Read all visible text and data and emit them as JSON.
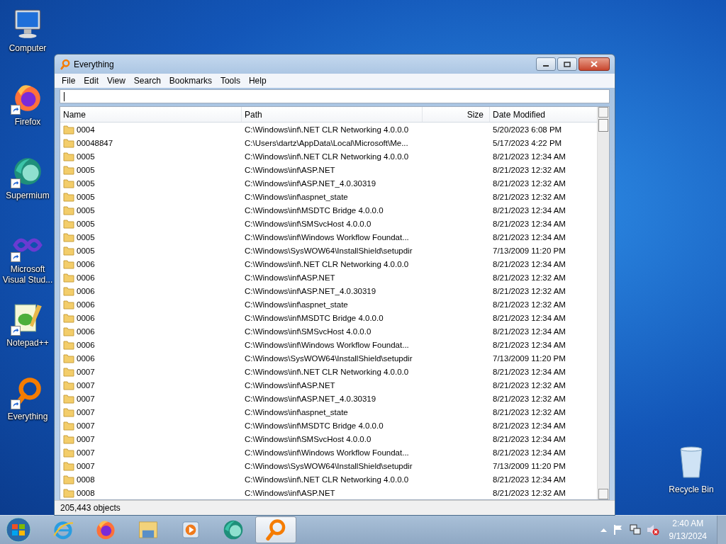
{
  "desktop_icons": [
    {
      "label": "Computer",
      "kind": "computer",
      "shortcut": false
    },
    {
      "label": "Firefox",
      "kind": "firefox",
      "shortcut": true
    },
    {
      "label": "Supermium",
      "kind": "supermium",
      "shortcut": true
    },
    {
      "label": "Microsoft Visual Stud...",
      "kind": "vs",
      "shortcut": true
    },
    {
      "label": "Notepad++",
      "kind": "notepad",
      "shortcut": true
    },
    {
      "label": "Everything",
      "kind": "everything",
      "shortcut": true
    }
  ],
  "recycle_bin": {
    "label": "Recycle Bin"
  },
  "window": {
    "title": "Everything",
    "menu": [
      "File",
      "Edit",
      "View",
      "Search",
      "Bookmarks",
      "Tools",
      "Help"
    ],
    "table": {
      "columns": [
        "Name",
        "Path",
        "Size",
        "Date Modified"
      ],
      "rows": [
        [
          "0004",
          "C:\\Windows\\inf\\.NET CLR Networking 4.0.0.0",
          "",
          "5/20/2023 6:08 PM"
        ],
        [
          "00048847",
          "C:\\Users\\dartz\\AppData\\Local\\Microsoft\\Me...",
          "",
          "5/17/2023 4:22 PM"
        ],
        [
          "0005",
          "C:\\Windows\\inf\\.NET CLR Networking 4.0.0.0",
          "",
          "8/21/2023 12:34 AM"
        ],
        [
          "0005",
          "C:\\Windows\\inf\\ASP.NET",
          "",
          "8/21/2023 12:32 AM"
        ],
        [
          "0005",
          "C:\\Windows\\inf\\ASP.NET_4.0.30319",
          "",
          "8/21/2023 12:32 AM"
        ],
        [
          "0005",
          "C:\\Windows\\inf\\aspnet_state",
          "",
          "8/21/2023 12:32 AM"
        ],
        [
          "0005",
          "C:\\Windows\\inf\\MSDTC Bridge 4.0.0.0",
          "",
          "8/21/2023 12:34 AM"
        ],
        [
          "0005",
          "C:\\Windows\\inf\\SMSvcHost 4.0.0.0",
          "",
          "8/21/2023 12:34 AM"
        ],
        [
          "0005",
          "C:\\Windows\\inf\\Windows Workflow Foundat...",
          "",
          "8/21/2023 12:34 AM"
        ],
        [
          "0005",
          "C:\\Windows\\SysWOW64\\InstallShield\\setupdir",
          "",
          "7/13/2009 11:20 PM"
        ],
        [
          "0006",
          "C:\\Windows\\inf\\.NET CLR Networking 4.0.0.0",
          "",
          "8/21/2023 12:34 AM"
        ],
        [
          "0006",
          "C:\\Windows\\inf\\ASP.NET",
          "",
          "8/21/2023 12:32 AM"
        ],
        [
          "0006",
          "C:\\Windows\\inf\\ASP.NET_4.0.30319",
          "",
          "8/21/2023 12:32 AM"
        ],
        [
          "0006",
          "C:\\Windows\\inf\\aspnet_state",
          "",
          "8/21/2023 12:32 AM"
        ],
        [
          "0006",
          "C:\\Windows\\inf\\MSDTC Bridge 4.0.0.0",
          "",
          "8/21/2023 12:34 AM"
        ],
        [
          "0006",
          "C:\\Windows\\inf\\SMSvcHost 4.0.0.0",
          "",
          "8/21/2023 12:34 AM"
        ],
        [
          "0006",
          "C:\\Windows\\inf\\Windows Workflow Foundat...",
          "",
          "8/21/2023 12:34 AM"
        ],
        [
          "0006",
          "C:\\Windows\\SysWOW64\\InstallShield\\setupdir",
          "",
          "7/13/2009 11:20 PM"
        ],
        [
          "0007",
          "C:\\Windows\\inf\\.NET CLR Networking 4.0.0.0",
          "",
          "8/21/2023 12:34 AM"
        ],
        [
          "0007",
          "C:\\Windows\\inf\\ASP.NET",
          "",
          "8/21/2023 12:32 AM"
        ],
        [
          "0007",
          "C:\\Windows\\inf\\ASP.NET_4.0.30319",
          "",
          "8/21/2023 12:32 AM"
        ],
        [
          "0007",
          "C:\\Windows\\inf\\aspnet_state",
          "",
          "8/21/2023 12:32 AM"
        ],
        [
          "0007",
          "C:\\Windows\\inf\\MSDTC Bridge 4.0.0.0",
          "",
          "8/21/2023 12:34 AM"
        ],
        [
          "0007",
          "C:\\Windows\\inf\\SMSvcHost 4.0.0.0",
          "",
          "8/21/2023 12:34 AM"
        ],
        [
          "0007",
          "C:\\Windows\\inf\\Windows Workflow Foundat...",
          "",
          "8/21/2023 12:34 AM"
        ],
        [
          "0007",
          "C:\\Windows\\SysWOW64\\InstallShield\\setupdir",
          "",
          "7/13/2009 11:20 PM"
        ],
        [
          "0008",
          "C:\\Windows\\inf\\.NET CLR Networking 4.0.0.0",
          "",
          "8/21/2023 12:34 AM"
        ],
        [
          "0008",
          "C:\\Windows\\inf\\ASP.NET",
          "",
          "8/21/2023 12:32 AM"
        ]
      ]
    },
    "status_bar": "205,443 objects"
  },
  "taskbar": {
    "items": [
      {
        "kind": "ie",
        "selected": false
      },
      {
        "kind": "firefox",
        "selected": false
      },
      {
        "kind": "explorer",
        "selected": false
      },
      {
        "kind": "media",
        "selected": false
      },
      {
        "kind": "supermium",
        "selected": false
      },
      {
        "kind": "everything",
        "selected": true
      }
    ],
    "time": "2:40 AM",
    "date": "9/13/2024"
  }
}
